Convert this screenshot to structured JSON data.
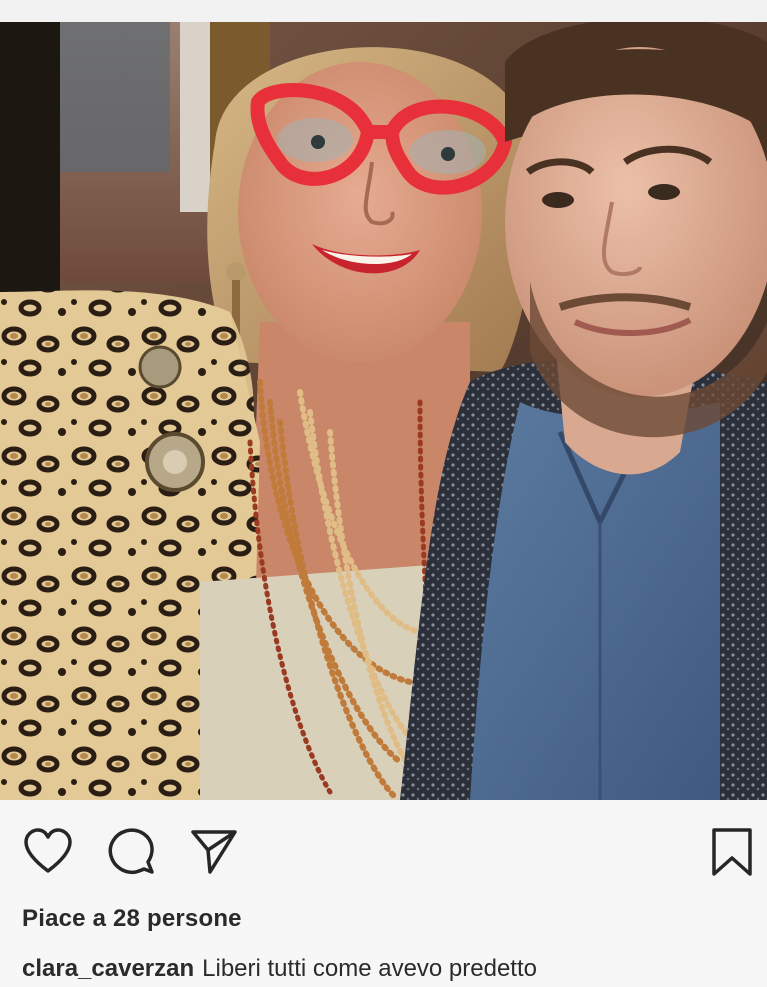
{
  "post": {
    "image_alt": "selfie of a woman in red glasses and leopard print coat with a bearded man",
    "actions": {
      "like_icon": "heart-icon",
      "comment_icon": "comment-icon",
      "share_icon": "send-icon",
      "save_icon": "bookmark-icon"
    },
    "likes_text": "Piace a 28 persone",
    "username": "clara_caverzan",
    "caption": "Liberi tutti come avevo predetto"
  },
  "colors": {
    "background": "#f6f6f6",
    "text": "#262626",
    "glasses": "#e8303a",
    "leopard": "#e0c48a",
    "shirt": "#4d6a8e"
  }
}
